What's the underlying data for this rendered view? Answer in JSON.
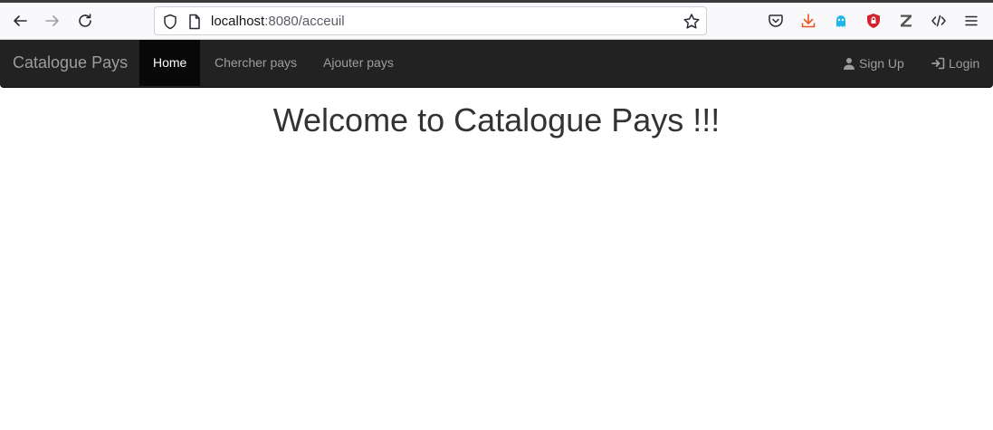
{
  "browser": {
    "url_host": "localhost",
    "url_rest": ":8080/acceuil",
    "icons": [
      "back-icon",
      "forward-icon",
      "reload-icon",
      "shield-icon",
      "page-icon",
      "bookmark-star-icon",
      "pocket-icon",
      "download-icon",
      "ghost-extension-icon",
      "ublock-shield-icon",
      "zotero-z-icon",
      "devtools-icon",
      "menu-icon"
    ],
    "colors": {
      "download": "#e8531f",
      "ghost": "#20b6e8",
      "ublock": "#d3232f"
    }
  },
  "navbar": {
    "brand": "Catalogue Pays",
    "items": [
      {
        "label": "Home",
        "active": true
      },
      {
        "label": "Chercher pays",
        "active": false
      },
      {
        "label": "Ajouter pays",
        "active": false
      }
    ],
    "right": [
      {
        "label": "Sign Up",
        "icon": "user-icon"
      },
      {
        "label": "Login",
        "icon": "login-icon"
      }
    ],
    "colors": {
      "background": "#222222",
      "active_background": "#080808",
      "link": "#9d9d9d",
      "active_link": "#ffffff"
    }
  },
  "main": {
    "title": "Welcome to Catalogue Pays !!!"
  }
}
